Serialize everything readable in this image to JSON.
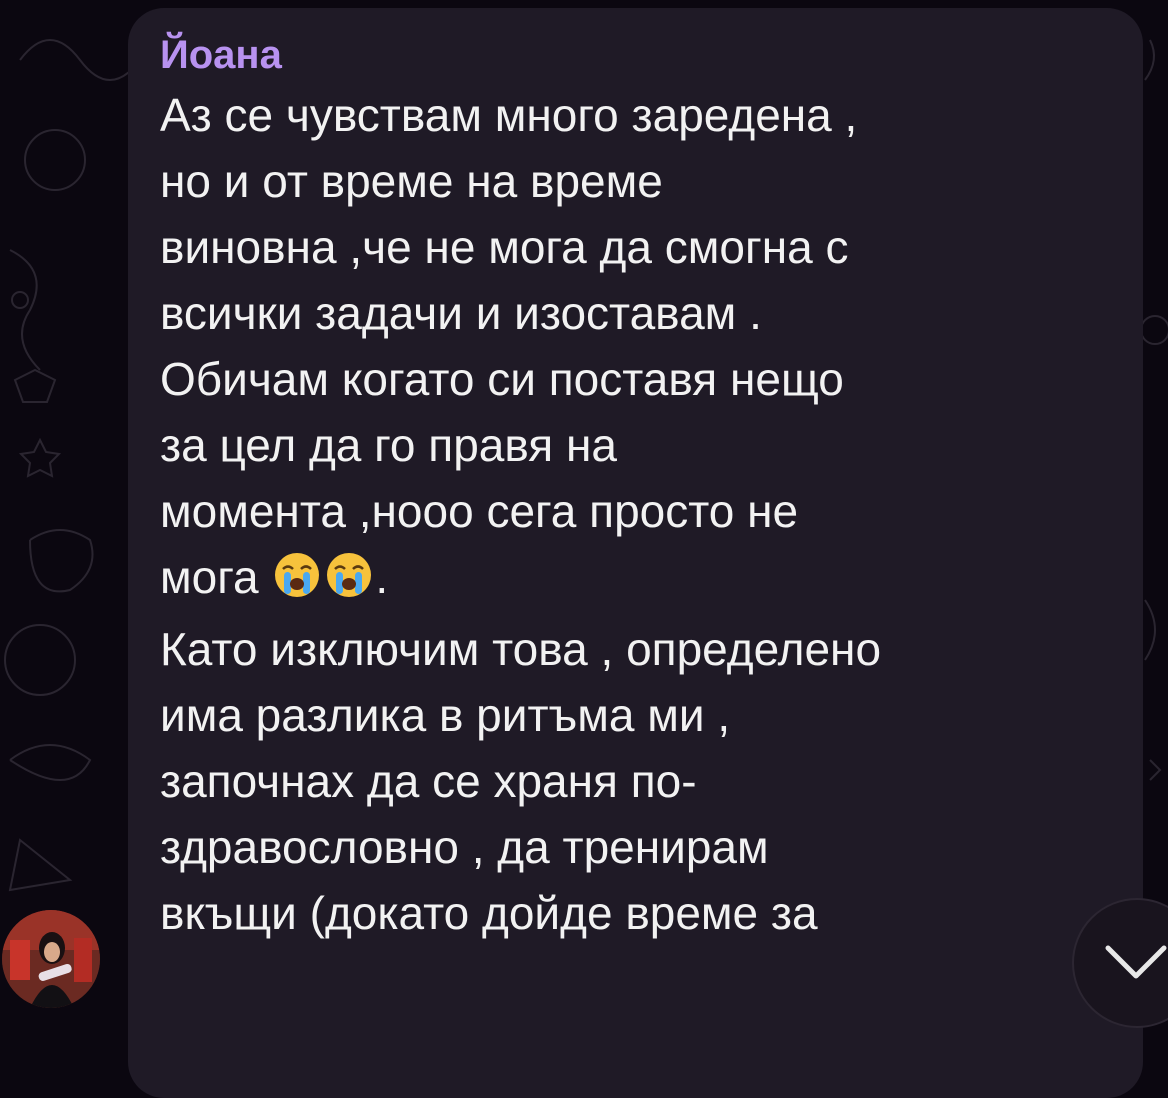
{
  "chat": {
    "message": {
      "sender": "Йоана",
      "lines": [
        "Аз се чувствам много заредена ,",
        "но и от време на време",
        "виновна ,че не мога да смогна с",
        "всички задачи и изоставам .",
        "Обичам когато си поставя нещо",
        "за цел да го правя на",
        "момента ,ноoо сега просто не",
        "мога",
        "Като изключим това , определено",
        "има разлика в ритъма ми ,",
        "започнах да се храня по-",
        "здравословно , да тренирам",
        "вкъщи (докато дойде време за"
      ],
      "line8_suffix": ".",
      "emojis": [
        "crying-face-emoji",
        "crying-face-emoji"
      ]
    },
    "colors": {
      "background": "#0b0710",
      "bubble": "#1f1a26",
      "sender": "#b892f0",
      "text": "#f2f2f2"
    },
    "icons": {
      "scroll_down": "chevron-down-icon",
      "avatar": "avatar"
    }
  }
}
